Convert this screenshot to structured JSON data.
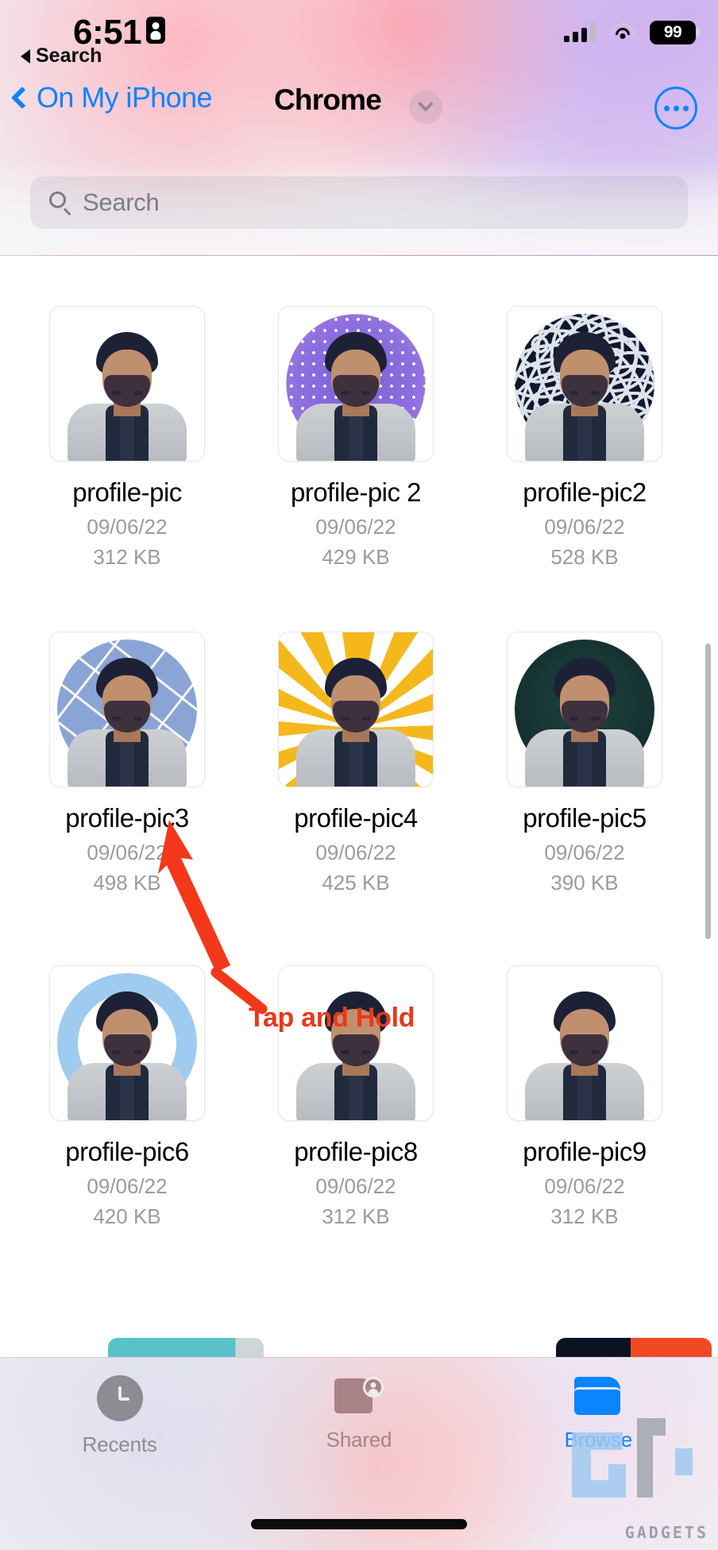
{
  "status_bar": {
    "time": "6:51",
    "back_label": "Search",
    "battery_percent": "99",
    "recording_icon": "screen-record-icon",
    "signal_icon": "cellular-signal-icon",
    "wifi_icon": "wifi-icon"
  },
  "nav": {
    "back_label": "On My iPhone",
    "title": "Chrome",
    "chevron_icon": "chevron-down-icon",
    "more_icon": "more-options-icon"
  },
  "search": {
    "placeholder": "Search",
    "value": "",
    "icon": "search-icon"
  },
  "files": [
    {
      "name": "profile-pic",
      "date": "09/06/22",
      "size": "312 KB",
      "style": "plain"
    },
    {
      "name": "profile-pic 2",
      "date": "09/06/22",
      "size": "429 KB",
      "style": "halftone-purple"
    },
    {
      "name": "profile-pic2",
      "date": "09/06/22",
      "size": "528 KB",
      "style": "maze-navy"
    },
    {
      "name": "profile-pic3",
      "date": "09/06/22",
      "size": "498 KB",
      "style": "confetti-blue"
    },
    {
      "name": "profile-pic4",
      "date": "09/06/22",
      "size": "425 KB",
      "style": "sunburst-yellow"
    },
    {
      "name": "profile-pic5",
      "date": "09/06/22",
      "size": "390 KB",
      "style": "dark-green"
    },
    {
      "name": "profile-pic6",
      "date": "09/06/22",
      "size": "420 KB",
      "style": "ring-lightblue"
    },
    {
      "name": "profile-pic8",
      "date": "09/06/22",
      "size": "312 KB",
      "style": "plain"
    },
    {
      "name": "profile-pic9",
      "date": "09/06/22",
      "size": "312 KB",
      "style": "plain"
    }
  ],
  "annotation": {
    "caption": "Tap and Hold",
    "color": "#e8391b",
    "arrow_icon": "red-arrow-icon"
  },
  "tabbar": {
    "items": [
      {
        "label": "Recents",
        "icon": "clock-icon",
        "active": false
      },
      {
        "label": "Shared",
        "icon": "shared-folder-icon",
        "active": false
      },
      {
        "label": "Browse",
        "icon": "folder-icon",
        "active": true
      }
    ],
    "active_color": "#0a84ff"
  },
  "watermark": {
    "text": "GADGETS"
  }
}
